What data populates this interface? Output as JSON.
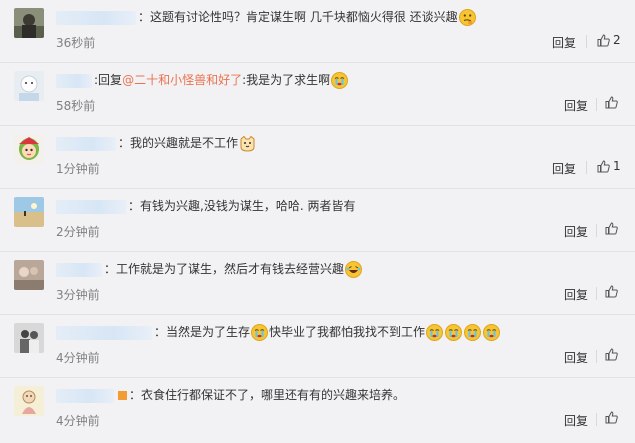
{
  "actions": {
    "reply_label": "回复"
  },
  "comments": [
    {
      "before_text": "：这题有讨论性吗？肯定谋生啊 几千块都恼火得很 还谈兴趣",
      "time": "36秒前",
      "likes": "2",
      "emoji": "thinking-emoji"
    },
    {
      "reply_prefix": "回复",
      "mention": "@二十和小怪兽和好了",
      "after_text": ":我是为了求生啊",
      "time": "58秒前",
      "likes": "",
      "emoji": "crying-emoji"
    },
    {
      "before_text": "：我的兴趣就是不工作",
      "time": "1分钟前",
      "likes": "1",
      "emoji": "cat-emoji"
    },
    {
      "before_text": "：有钱为兴趣,没钱为谋生，哈哈. 两者皆有",
      "time": "2分钟前",
      "likes": ""
    },
    {
      "before_text": "：工作就是为了谋生，然后才有钱去经营兴趣",
      "time": "3分钟前",
      "likes": "",
      "emoji": "laughing-emoji"
    },
    {
      "before_text": "：当然是为了生存",
      "middle_text": "快毕业了我都怕我找不到工作",
      "time": "4分钟前",
      "likes": ""
    },
    {
      "before_text": "：衣食住行都保证不了，哪里还有有的兴趣来培养。",
      "time": "4分钟前",
      "likes": ""
    }
  ]
}
